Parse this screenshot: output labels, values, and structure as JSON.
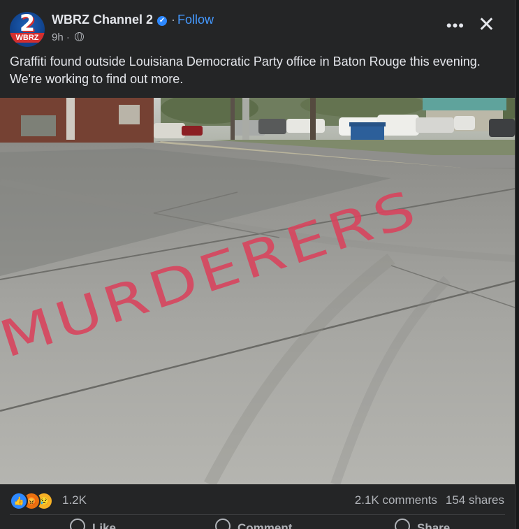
{
  "post": {
    "page_name": "WBRZ Channel 2",
    "follow_label": "Follow",
    "separator": "·",
    "time": "9h",
    "time_separator": "·",
    "avatar_number": "2",
    "avatar_text": "WBRZ",
    "caption": "Graffiti found outside Louisiana Democratic Party office in Baton Rouge this evening. We're working to find out more.",
    "photo_graffiti_text": "MURDERERS"
  },
  "icons": {
    "verified": "verified-check-icon",
    "audience": "globe-icon",
    "more": "more-options-icon",
    "close": "close-icon",
    "reactions": [
      "like-reaction-icon",
      "angry-reaction-icon",
      "sad-reaction-icon"
    ]
  },
  "engagement": {
    "reaction_count": "1.2K",
    "comments": "2.1K comments",
    "shares": "154 shares"
  },
  "actions": {
    "like": "Like",
    "comment": "Comment",
    "share": "Share"
  },
  "colors": {
    "background": "#242526",
    "text": "#e4e6eb",
    "secondary_text": "#b0b3b8",
    "link": "#4599ff",
    "verified": "#2d88ff",
    "graffiti": "#d8455e"
  }
}
